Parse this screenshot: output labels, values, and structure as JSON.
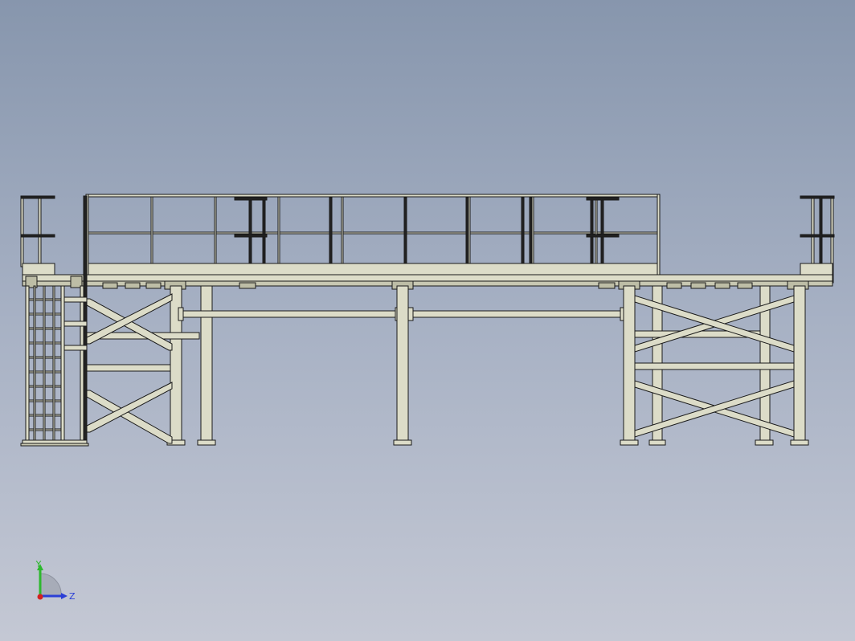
{
  "viewport": {
    "background_top": "#8796ad",
    "background_bottom": "#c4c8d4"
  },
  "model": {
    "description_type": "steel-platform-side-elevation",
    "fill_color": "#dcdcc8",
    "line_color": "#1a1a1a"
  },
  "triad": {
    "y_label": "Y",
    "z_label": "Z",
    "y_color": "#2db82d",
    "z_color": "#2b3fd6",
    "origin_color": "#d42020"
  }
}
